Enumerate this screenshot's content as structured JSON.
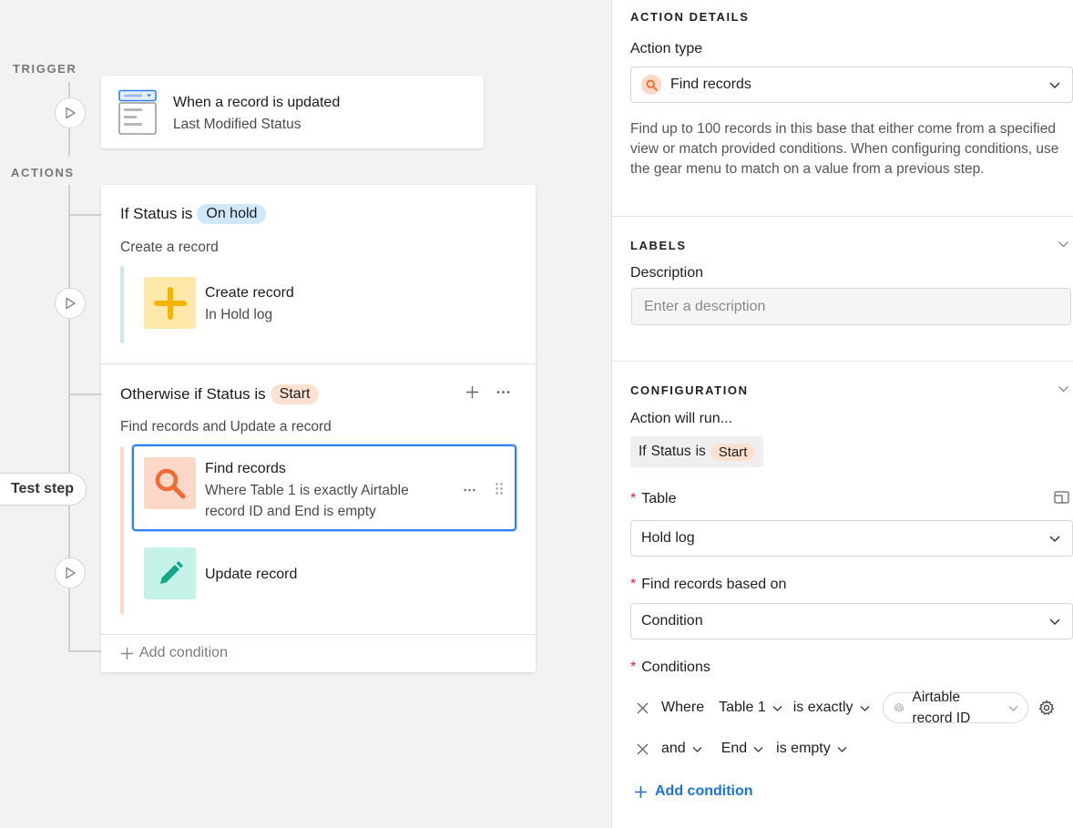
{
  "canvas": {
    "trigger_label": "TRIGGER",
    "actions_label": "ACTIONS",
    "trigger": {
      "title": "When a record is updated",
      "subtitle": "Last Modified Status"
    },
    "branch1": {
      "title_prefix": "If Status is",
      "pill": "On hold",
      "subtitle": "Create a record",
      "step": {
        "title": "Create record",
        "subtitle": "In Hold log"
      }
    },
    "branch2": {
      "title_prefix": "Otherwise if Status is",
      "pill": "Start",
      "subtitle": "Find records and Update a record",
      "step1": {
        "title": "Find records",
        "subtitle": "Where Table 1 is exactly Airtable record ID and End is empty"
      },
      "step2": {
        "title": "Update record"
      }
    },
    "add_condition": "Add condition",
    "test_step": "Test step"
  },
  "panel": {
    "action_details_heading": "ACTION DETAILS",
    "action_type_label": "Action type",
    "action_type_value": "Find records",
    "description": "Find up to 100 records in this base that either come from a specified view or match provided conditions. When configuring conditions, use the gear menu to match on a value from a previous step.",
    "labels_heading": "LABELS",
    "description_label": "Description",
    "description_placeholder": "Enter a description",
    "configuration_heading": "CONFIGURATION",
    "action_will_run": "Action will run...",
    "runs_if": "If",
    "runs_field": "Status",
    "runs_is": "is",
    "runs_value": "Start",
    "table_label": "Table",
    "table_value": "Hold log",
    "find_based_label": "Find records based on",
    "find_based_value": "Condition",
    "conditions_label": "Conditions",
    "conditions": [
      {
        "connector": "Where",
        "field": "Table 1",
        "operator": "is exactly",
        "value_line1": "Airtable",
        "value_line2": "record ID"
      },
      {
        "connector": "and",
        "field": "End",
        "operator": "is empty"
      }
    ],
    "add_condition": "Add condition"
  },
  "colors": {
    "accent_blue": "#2d7ff9",
    "link_blue": "#1a73d9",
    "pill_blue": "#cfe9fb",
    "pill_orange": "#fde0d0",
    "create_tile": "#fde7a9",
    "create_icon": "#f5b400",
    "find_tile": "#fdd8c8",
    "find_icon": "#f06a32",
    "update_tile": "#c4f2e6",
    "update_icon": "#17a58a",
    "required": "#e01c3c"
  }
}
